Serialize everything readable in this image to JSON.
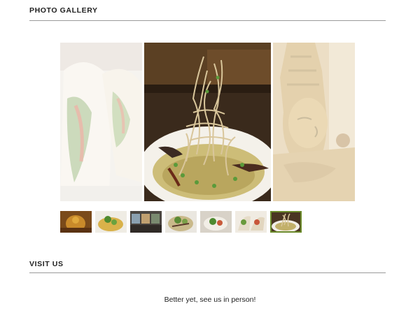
{
  "gallery": {
    "title": "PHOTO GALLERY",
    "slides": [
      {
        "name": "tacos"
      },
      {
        "name": "curry-noodle-dish"
      },
      {
        "name": "golden-buddha-statue"
      }
    ],
    "active_thumbnail": 7,
    "thumbnail_count": 7
  },
  "visit": {
    "title": "VISIT US",
    "tagline": "Better yet, see us in person!"
  },
  "colors": {
    "rule": "#9a9a9a",
    "active_thumb_border": "#6b8a2a"
  }
}
